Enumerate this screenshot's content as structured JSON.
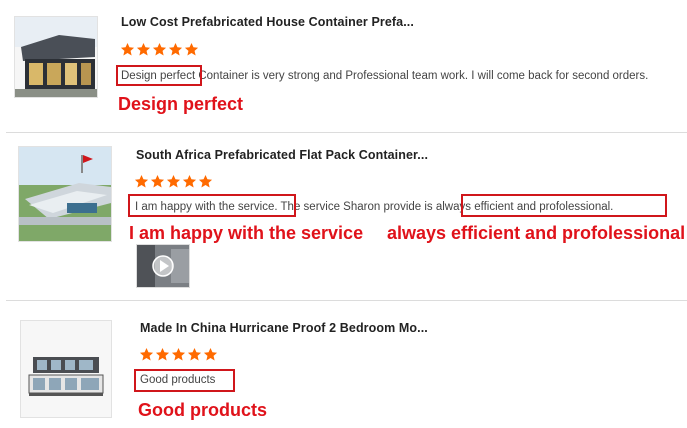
{
  "reviews": [
    {
      "title": "Low Cost Prefabricated House Container Prefa...",
      "rating": 5,
      "text_highlight": "Design perfect",
      "text_rest": " Container is very strong and Professional team work. I will come back for second orders.",
      "annotation": "Design perfect",
      "image": "house-container-photo"
    },
    {
      "title": "South Africa Prefabricated Flat Pack Container...",
      "rating": 5,
      "text_highlight_1": "I am happy with the service.",
      "text_middle": " The service Sharon provide is ",
      "text_highlight_2": "always efficient and profolessional.",
      "annotation_1": "I am happy with the service",
      "annotation_2": "always efficient and profolessional",
      "image": "flat-pack-container-site-photo",
      "attachment": "video-thumbnail"
    },
    {
      "title": "Made In China Hurricane Proof 2 Bedroom Mo...",
      "rating": 5,
      "text_highlight": "Good products",
      "annotation": "Good products",
      "image": "stacked-container-house-photo"
    }
  ],
  "colors": {
    "star": "#ff6a00",
    "highlight_box": "#d0161b",
    "annotation": "#e0121a"
  },
  "icons": {
    "star": "star-icon",
    "play": "play-icon"
  }
}
